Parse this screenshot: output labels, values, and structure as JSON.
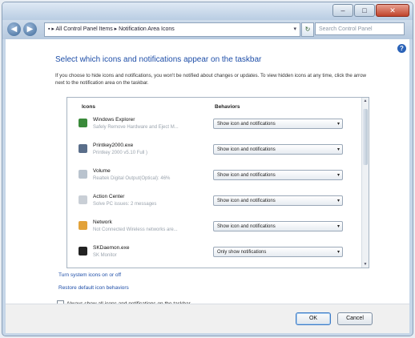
{
  "window": {
    "controls": [
      "–",
      "□",
      "✕"
    ]
  },
  "navbar": {
    "back_icon": "back-arrow-icon",
    "forward_icon": "forward-arrow-icon",
    "breadcrumb": "▪ ▸ All Control Panel Items ▸ Notification Area Icons",
    "address_dropdown": "▾",
    "refresh_icon": "↻",
    "search_placeholder": "Search Control Panel"
  },
  "content": {
    "help_icon": "?",
    "heading": "Select which icons and notifications appear on the taskbar",
    "description": "If you choose to hide icons and notifications, you won't be notified about changes or updates. To view hidden icons at any time, click the arrow next to the notification area on the taskbar.",
    "columns": {
      "icons": "Icons",
      "behaviors": "Behaviors"
    },
    "rows": [
      {
        "name": "Windows Explorer",
        "desc": "Safely Remove Hardware and Eject M...",
        "behavior": "Show icon and notifications",
        "icon_color": "#3a8a3a"
      },
      {
        "name": "Printkey2000.exe",
        "desc": "Printkey 2000 v5.10 Full )",
        "behavior": "Show icon and notifications",
        "icon_color": "#5a6e8a"
      },
      {
        "name": "Volume",
        "desc": "Realtek Digital Output(Optical): 46%",
        "behavior": "Show icon and notifications",
        "icon_color": "#b9c3ce"
      },
      {
        "name": "Action Center",
        "desc": "Solve PC issues: 2 messages",
        "behavior": "Show icon and notifications",
        "icon_color": "#c9cfd6"
      },
      {
        "name": "Network",
        "desc": "Not Connected Wireless networks are...",
        "behavior": "Show icon and notifications",
        "icon_color": "#e2a23a"
      },
      {
        "name": "SKDaemon.exe",
        "desc": "SK Monitor",
        "behavior": "Only show notifications",
        "icon_color": "#222222"
      }
    ],
    "dropdown_arrow": "▾",
    "scroll_up": "▲",
    "scroll_down": "▼",
    "link_system_icons": "Turn system icons on or off",
    "link_restore": "Restore default icon behaviors",
    "checkbox_label": "Always show all icons and notifications on the taskbar"
  },
  "footer": {
    "ok": "OK",
    "cancel": "Cancel"
  }
}
